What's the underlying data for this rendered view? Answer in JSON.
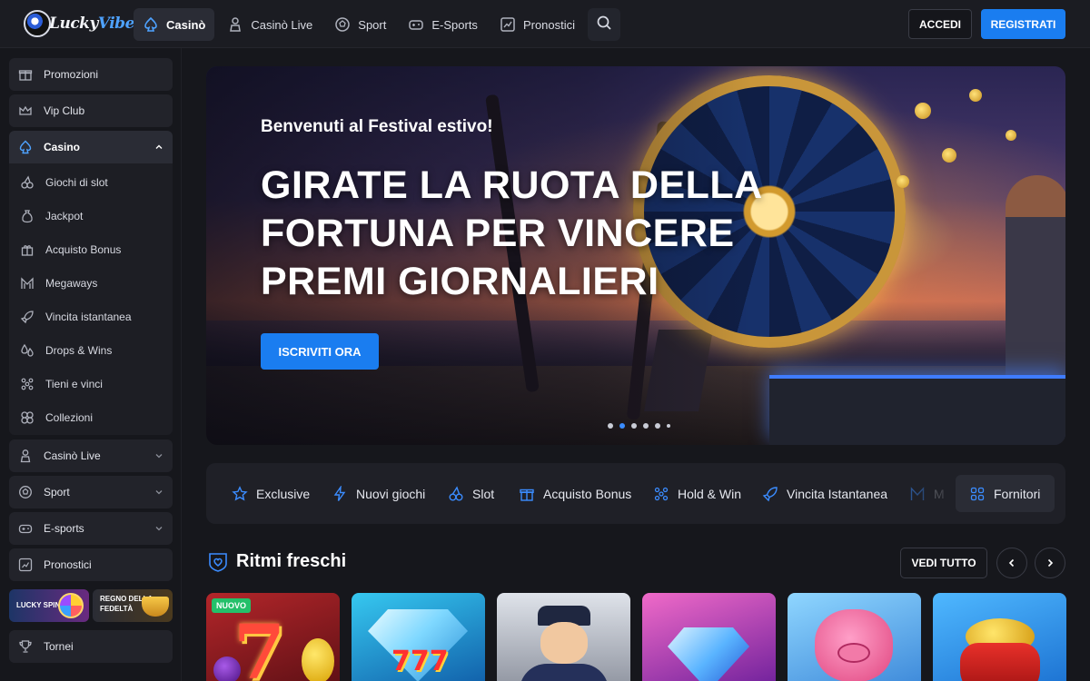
{
  "brand": {
    "name_part1": "Lucky",
    "name_part2": "Vibe"
  },
  "nav": [
    {
      "label": "Casinò",
      "icon": "spade-icon",
      "active": true
    },
    {
      "label": "Casinò Live",
      "icon": "dealer-icon",
      "active": false
    },
    {
      "label": "Sport",
      "icon": "soccer-ball-icon",
      "active": false
    },
    {
      "label": "E-Sports",
      "icon": "gamepad-icon",
      "active": false
    },
    {
      "label": "Pronostici",
      "icon": "chart-icon",
      "active": false
    }
  ],
  "auth": {
    "login": "ACCEDI",
    "register": "REGISTRATI"
  },
  "sidebar": {
    "top": [
      {
        "label": "Promozioni",
        "icon": "gift-icon"
      },
      {
        "label": "Vip Club",
        "icon": "crown-icon"
      }
    ],
    "casino": {
      "label": "Casino",
      "icon": "spade-icon"
    },
    "submenu": [
      {
        "label": "Giochi di slot",
        "icon": "cherries-icon"
      },
      {
        "label": "Jackpot",
        "icon": "money-bag-icon"
      },
      {
        "label": "Acquisto Bonus",
        "icon": "gift-box-icon"
      },
      {
        "label": "Megaways",
        "icon": "megaways-icon"
      },
      {
        "label": "Vincita istantanea",
        "icon": "rocket-icon"
      },
      {
        "label": "Drops & Wins",
        "icon": "drops-icon"
      },
      {
        "label": "Tieni e vinci",
        "icon": "grid-dots-icon"
      },
      {
        "label": "Collezioni",
        "icon": "collections-icon"
      }
    ],
    "sections": [
      {
        "label": "Casinò Live",
        "icon": "dealer-icon"
      },
      {
        "label": "Sport",
        "icon": "soccer-ball-icon"
      },
      {
        "label": "E-sports",
        "icon": "gamepad-icon"
      },
      {
        "label": "Pronostici",
        "icon": "chart-icon"
      }
    ],
    "promo_cards": [
      {
        "label": "LUCKY SPIN"
      },
      {
        "label_line1": "REGNO DELLA",
        "label_line2": "FEDELTÀ"
      }
    ],
    "tornei": {
      "label": "Tornei",
      "icon": "trophy-icon"
    }
  },
  "hero": {
    "subtitle": "Benvenuti al Festival estivo!",
    "title_line1": "GIRATE LA RUOTA DELLA",
    "title_line2": "FORTUNA PER VINCERE",
    "title_line3": "PREMI GIORNALIERI",
    "cta": "ISCRIVITI ORA",
    "slides_total": 6,
    "active_slide": 2
  },
  "categories": [
    {
      "label": "Exclusive",
      "icon": "star-icon"
    },
    {
      "label": "Nuovi giochi",
      "icon": "lightning-icon"
    },
    {
      "label": "Slot",
      "icon": "cherries-icon"
    },
    {
      "label": "Acquisto Bonus",
      "icon": "gift-box-icon"
    },
    {
      "label": "Hold & Win",
      "icon": "grid-dots-icon"
    },
    {
      "label": "Vincita Istantanea",
      "icon": "rocket-icon"
    },
    {
      "label": "M",
      "icon": "megaways-icon"
    }
  ],
  "providers": {
    "label": "Fornitori",
    "icon": "providers-grid-icon"
  },
  "section": {
    "title": "Ritmi freschi",
    "icon": "heart-shield-icon",
    "see_all": "VEDI TUTTO"
  },
  "games": [
    {
      "badge": "NUOVO",
      "theme": "seven-fruits"
    },
    {
      "theme": "diamond-777"
    },
    {
      "theme": "sailor"
    },
    {
      "theme": "pink-diamond"
    },
    {
      "theme": "pink-pig"
    },
    {
      "theme": "red-pot-gold"
    }
  ],
  "colors": {
    "accent": "#1a7df0",
    "background": "#16171c",
    "panel": "#22232a",
    "new_badge": "#24c06a"
  }
}
